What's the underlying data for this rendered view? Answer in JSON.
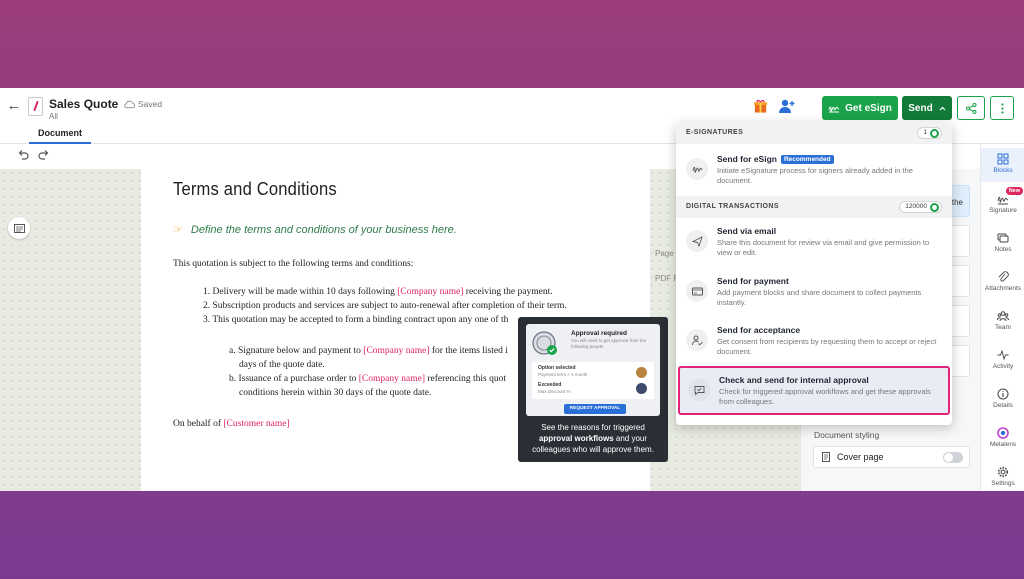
{
  "header": {
    "doc_title": "Sales Quote",
    "doc_sub": "All",
    "saved": "Saved",
    "get_esign": "Get eSign",
    "send": "Send"
  },
  "tabs": {
    "document": "Document"
  },
  "document": {
    "title": "Terms and Conditions",
    "tip": "Define the terms and conditions of your business here.",
    "intro": "This quotation is subject to the following terms and conditions:",
    "items": [
      {
        "num": "1.",
        "pre": "Delivery will be made within 10 days following ",
        "ph": "[Company name]",
        "post": " receiving the payment."
      },
      {
        "num": "2.",
        "pre": "Subscription products and services are subject to auto-renewal after completion of their term.",
        "ph": "",
        "post": ""
      },
      {
        "num": "3.",
        "pre": "This quotation may be accepted to form a binding contract upon any one of th",
        "ph": "",
        "post": ""
      }
    ],
    "subitems": [
      {
        "num": "a.",
        "pre": "Signature below and payment to ",
        "ph": "[Company name]",
        "post": " for the items listed i",
        "line2": "days of the quote date."
      },
      {
        "num": "b.",
        "pre": "Issuance of a purchase order to ",
        "ph": "[Company name]",
        "post": " referencing this quot",
        "line2": "conditions herein within 30 days of the quote date."
      }
    ],
    "on_behalf": "On behalf of ",
    "customer_ph": "[Customer name]"
  },
  "side_strip": {
    "page": "Page",
    "pdf": "PDF R"
  },
  "right_panel": {
    "peek_text": "the",
    "styling": "Document styling",
    "cover_page": "Cover page"
  },
  "right_nav": [
    {
      "label": "Blocks",
      "icon": "blocks-icon"
    },
    {
      "label": "Signature",
      "icon": "signature-icon",
      "badge": "New"
    },
    {
      "label": "Notes",
      "icon": "notes-icon"
    },
    {
      "label": "Attachments",
      "icon": "paperclip-icon"
    },
    {
      "label": "Team",
      "icon": "team-icon"
    },
    {
      "label": "Activity",
      "icon": "activity-icon"
    },
    {
      "label": "Details",
      "icon": "info-icon"
    },
    {
      "label": "Metalens",
      "icon": "metalens-icon"
    },
    {
      "label": "Settings",
      "icon": "gear-icon"
    }
  ],
  "dropdown": {
    "esig_section": "E-SIGNATURES",
    "esig_count": "1",
    "send_esign_title": "Send for eSign",
    "recommended": "Recommended",
    "send_esign_desc": "Initiate eSignature process for signers already added in the document.",
    "dt_section": "DIGITAL TRANSACTIONS",
    "dt_count": "120000",
    "email_title": "Send via email",
    "email_desc": "Share this document for review via email and give permission to view or edit.",
    "payment_title": "Send for payment",
    "payment_desc": "Add payment blocks and share document to collect payments instantly.",
    "accept_title": "Send for acceptance",
    "accept_desc": "Get consent from recipients by requesting them to accept or reject document.",
    "approval_title": "Check and send for internal approval",
    "approval_desc": "Check for triggered approval workflows and get these approvals from colleagues."
  },
  "tooltip": {
    "card_title": "Approval required",
    "card_sub": "You will need to get approval from the following people",
    "opt_label": "Option selected",
    "opt_value": "Payment term > 1 month",
    "exc_label": "Exceeded",
    "exc_value": "Max Discount %",
    "request_btn": "REQUEST APPROVAL",
    "t1": "See the reasons for triggered ",
    "t2": "approval workflows",
    "t3": " and your colleagues who will approve them."
  },
  "colors": {
    "brand_green": "#1aa34a",
    "send_green": "#137b39",
    "highlight": "#e0247a",
    "placeholder_red": "#e0245e",
    "link_blue": "#2a6ed8"
  }
}
